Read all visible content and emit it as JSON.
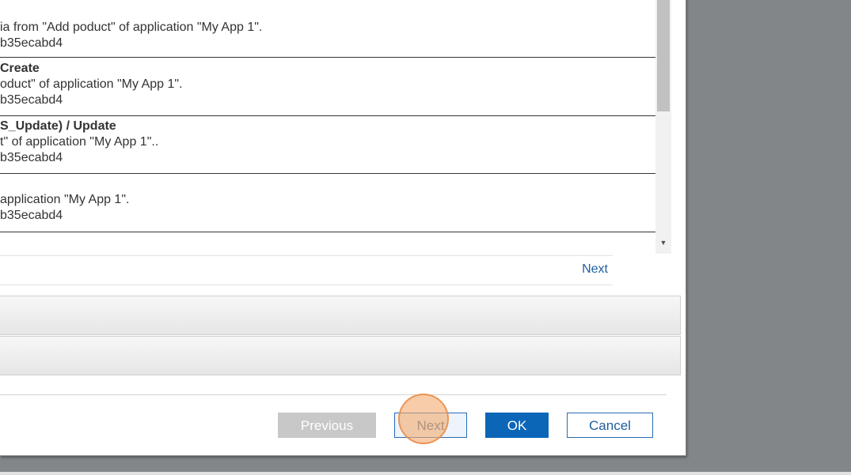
{
  "list": {
    "items": [
      {
        "title": "",
        "lines": [
          "ia from \"Add poduct\" of application \"My App 1\".",
          "b35ecabd4"
        ]
      },
      {
        "title": "Create",
        "lines": [
          "oduct\" of application \"My App 1\".",
          "b35ecabd4"
        ]
      },
      {
        "title": "S_Update) / Update",
        "lines": [
          "t\" of application \"My App 1\"..",
          "b35ecabd4"
        ]
      },
      {
        "title": "",
        "lines": [
          "application \"My App 1\".",
          "b35ecabd4"
        ]
      }
    ]
  },
  "scrollbar": {
    "down_arrow": "▼"
  },
  "pager": {
    "next_label": "Next"
  },
  "footer": {
    "previous_label": "Previous",
    "next_label": "Next",
    "ok_label": "OK",
    "cancel_label": "Cancel"
  },
  "colors": {
    "primary": "#0b66b8",
    "link": "#1f5e9e",
    "click_marker": "#f3aa6e"
  }
}
